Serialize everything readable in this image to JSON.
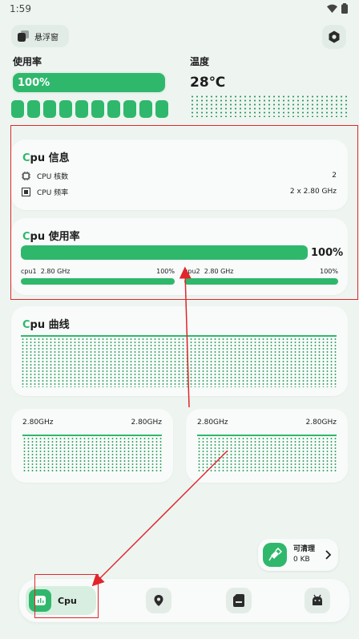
{
  "status": {
    "time": "1:59"
  },
  "header": {
    "floating_window_label": "悬浮窗"
  },
  "usage": {
    "label": "使用率",
    "value": "100%"
  },
  "temperature": {
    "label": "温度",
    "value": "28℃"
  },
  "cpu_info": {
    "title_prefix": "C",
    "title_rest": "pu 信息",
    "rows": [
      {
        "label": "CPU 核数",
        "value": "2"
      },
      {
        "label": "CPU 频率",
        "value": "2 x 2.80 GHz"
      }
    ]
  },
  "cpu_usage": {
    "title_prefix": "C",
    "title_rest": "pu 使用率",
    "total": "100%",
    "cores": [
      {
        "name": "cpu1",
        "freq": "2.80 GHz",
        "usage": "100%"
      },
      {
        "name": "cpu2",
        "freq": "2.80 GHz",
        "usage": "100%"
      }
    ]
  },
  "cpu_curve": {
    "title_prefix": "C",
    "title_rest": "pu 曲线"
  },
  "freq_cards": [
    {
      "left": "2.80GHz",
      "right": "2.80GHz"
    },
    {
      "left": "2.80GHz",
      "right": "2.80GHz"
    }
  ],
  "cleanup": {
    "title": "可清理",
    "size": "0 KB"
  },
  "nav": {
    "active_label": "Cpu"
  },
  "colors": {
    "accent": "#2fb86c",
    "annotation": "#e0262b"
  }
}
